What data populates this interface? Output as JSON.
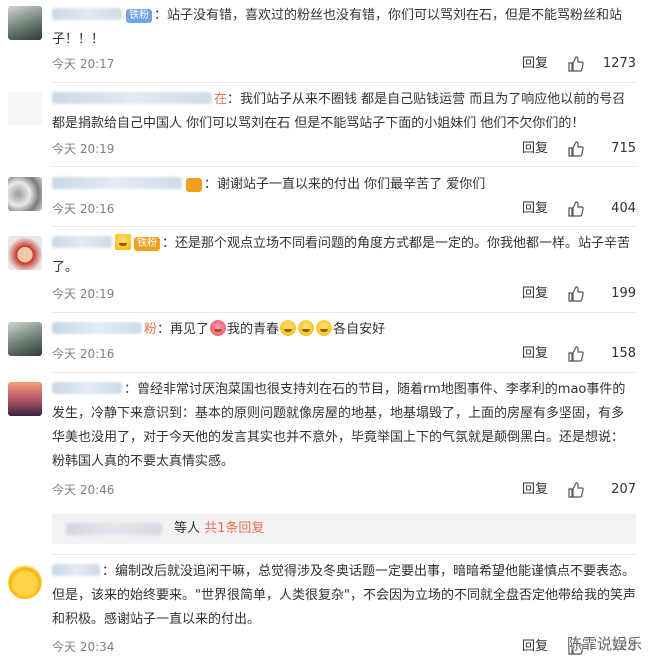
{
  "comments": [
    {
      "badge": "铁粉",
      "text": "站子没有错，喜欢过的粉丝也没有错，你们可以骂刘在石，但是不能骂粉丝和站子！！！",
      "time": "今天 20:17",
      "reply": "回复",
      "likes": "1273"
    },
    {
      "username_tail": "在",
      "text": "我们站子从来不圈钱 都是自己贴钱运营 而且为了响应他以前的号召 都是捐款给自己中国人 你们可以骂刘在石 但是不能骂站子下面的小姐妹们 他们不欠你们的！",
      "time": "今天 20:19",
      "reply": "回复",
      "likes": "715"
    },
    {
      "text": "谢谢站子一直以来的付出 你们最辛苦了 爱你们",
      "time": "今天 20:16",
      "reply": "回复",
      "likes": "404"
    },
    {
      "badge": "铁粉",
      "text": "还是那个观点立场不同看问题的角度方式都是一定的。你我他都一样。站子辛苦了。",
      "time": "今天 20:19",
      "reply": "回复",
      "likes": "199"
    },
    {
      "username_tail": "粉",
      "text_a": "再见了",
      "text_b": "我的青春",
      "text_c": "各自安好",
      "time": "今天 20:16",
      "reply": "回复",
      "likes": "158"
    },
    {
      "text": "曾经非常讨厌泡菜国也很支持刘在石的节目，随着rm地图事件、李孝利的mao事件的发生，冷静下来意识到：基本的原则问题就像房屋的地基，地基塌毁了，上面的房屋有多坚固，有多华美也没用了，对于今天他的发言其实也并不意外，毕竟举国上下的气氛就是颠倒黑白。还是想说：粉韩国人真的不要太真情实感。",
      "time": "今天 20:46",
      "reply": "回复",
      "likes": "207",
      "sub_reply": {
        "prefix": "等人",
        "link": "共1条回复"
      }
    },
    {
      "text": "编制改后就没追闲干嘛，总觉得涉及冬奥话题一定要出事，暗暗希望他能谨慎点不要表态。但是，该来的始终要来。\"世界很简单，人类很复杂\"，不会因为立场的不同就全盘否定他带给我的笑声和积极。感谢站子一直以来的付出。",
      "time": "今天 20:34",
      "reply": "回复",
      "likes": "123"
    }
  ],
  "watermark": "陈霏说娱乐",
  "colors": {
    "username": "#eb7350",
    "badge_iron": "#6fa4e8",
    "badge_gold": "#f0a020",
    "meta": "#808080",
    "divider": "#eaeaea"
  }
}
